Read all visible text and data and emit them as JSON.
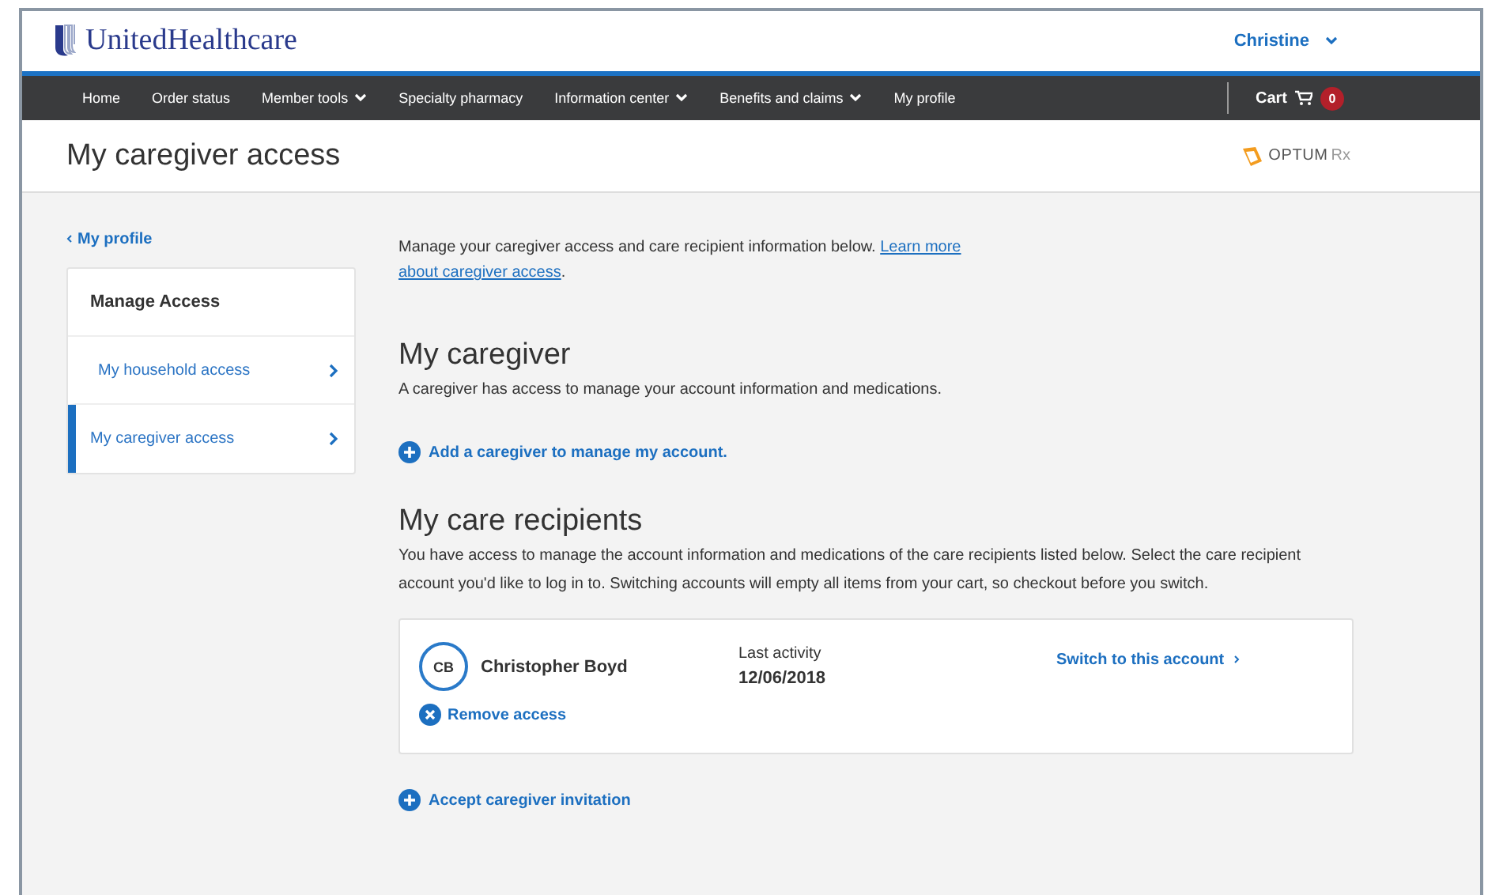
{
  "header": {
    "logo": "UnitedHealthcare",
    "user_menu": "Christine"
  },
  "nav": {
    "items": [
      {
        "label": "Home",
        "dropdown": false
      },
      {
        "label": "Order status",
        "dropdown": false
      },
      {
        "label": "Member tools",
        "dropdown": true
      },
      {
        "label": "Specialty pharmacy",
        "dropdown": false
      },
      {
        "label": "Information center",
        "dropdown": true
      },
      {
        "label": "Benefits and claims",
        "dropdown": true
      },
      {
        "label": "My profile",
        "dropdown": false
      }
    ],
    "cart": {
      "label": "Cart",
      "count": "0"
    }
  },
  "page_title": "My caregiver access",
  "partner_logo": {
    "text": "OPTUM",
    "suffix": "Rx"
  },
  "sidebar": {
    "back_link": "My profile",
    "heading": "Manage Access",
    "items": [
      {
        "label": "My household access",
        "selected": false
      },
      {
        "label": "My caregiver access",
        "selected": true
      }
    ]
  },
  "intro": {
    "text": "Manage your caregiver access and care recipient information below.",
    "link": "Learn more about caregiver access",
    "end": "."
  },
  "caregiver": {
    "title": "My caregiver",
    "description": "A caregiver has access to manage your account information and medications.",
    "add_link": "Add a caregiver to manage my account."
  },
  "recipients": {
    "title": "My care recipients",
    "description": "You have access to manage the account information and medications of the care recipients listed below. Select the care recipient account you'd like to log in to. Switching accounts will empty all items from your cart, so checkout before you switch.",
    "items": [
      {
        "initials": "CB",
        "name": "Christopher Boyd",
        "activity_label": "Last activity",
        "activity_date": "12/06/2018",
        "switch_link": "Switch to this account",
        "remove_link": "Remove access"
      }
    ],
    "accept_link": "Accept caregiver invitation"
  }
}
